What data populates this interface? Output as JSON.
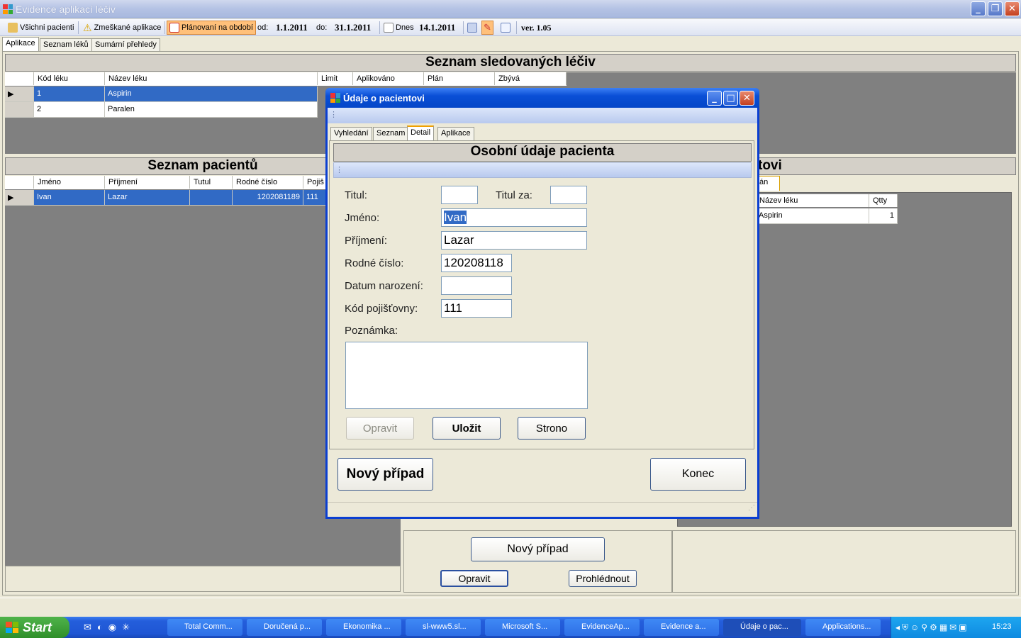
{
  "window": {
    "title": "Evidence aplikací léčiv"
  },
  "toolbar": {
    "all_patients": "Všichni pacienti",
    "missed": "Zmeškané aplikace",
    "planning": "Plánovaní na období",
    "from_label": "od:",
    "from_value": "1.1.2011",
    "to_label": "do:",
    "to_value": "31.1.2011",
    "today_label": "Dnes",
    "today_value": "14.1.2011",
    "version": "ver. 1.05"
  },
  "tabs": [
    "Aplikace",
    "Seznam léků",
    "Sumární přehledy"
  ],
  "drugs": {
    "title": "Seznam sledovaných léčiv",
    "columns": [
      "Kód léku",
      "Název léku",
      "Limit",
      "Aplikováno",
      "Plán",
      "Zbývá"
    ],
    "rows": [
      {
        "code": "1",
        "name": "Aspirin"
      },
      {
        "code": "2",
        "name": "Paralen"
      }
    ]
  },
  "patients": {
    "title": "Seznam pacientů",
    "columns": [
      "Jméno",
      "Příjmení",
      "Tutul",
      "Rodné číslo",
      "Pojiš"
    ],
    "rows": [
      {
        "first": "Ivan",
        "last": "Lazar",
        "title": "",
        "rc": "1202081189",
        "ins": "111"
      }
    ]
  },
  "right_panel": {
    "title_fragment": "tovi",
    "tab_fragment": "án",
    "columns": [
      "Název léku",
      "Qtty"
    ],
    "rows": [
      {
        "name": "Aspirin",
        "qty": "1"
      }
    ]
  },
  "bottom": {
    "new_case": "Nový případ",
    "edit": "Opravit",
    "view": "Prohlédnout"
  },
  "dialog": {
    "title": "Údaje o pacientovi",
    "tabs": [
      "Vyhledání",
      "Seznam",
      "Detail",
      "Aplikace"
    ],
    "section": "Osobní údaje pacienta",
    "labels": {
      "title": "Titul:",
      "title_after": "Titul za:",
      "first": "Jméno:",
      "last": "Příjmení:",
      "rc": "Rodné číslo:",
      "dob": "Datum narození:",
      "ins": "Kód pojišťovny:",
      "note": "Poznámka:"
    },
    "values": {
      "title": "",
      "title_after": "",
      "first": "Ivan",
      "last": "Lazar",
      "rc": "120208118",
      "dob": "",
      "ins": "111",
      "note": ""
    },
    "buttons": {
      "edit": "Opravit",
      "save": "Uložit",
      "cancel": "Strono",
      "new_case": "Nový případ",
      "close": "Konec"
    }
  },
  "taskbar": {
    "start": "Start",
    "tasks": [
      "Total Comm...",
      "Doručená p...",
      "Ekonomika ...",
      "sl-www5.sl...",
      "Microsoft S...",
      "EvidenceAp...",
      "Evidence a...",
      "Údaje o pac...",
      "Applications..."
    ],
    "clock": "15:23"
  }
}
